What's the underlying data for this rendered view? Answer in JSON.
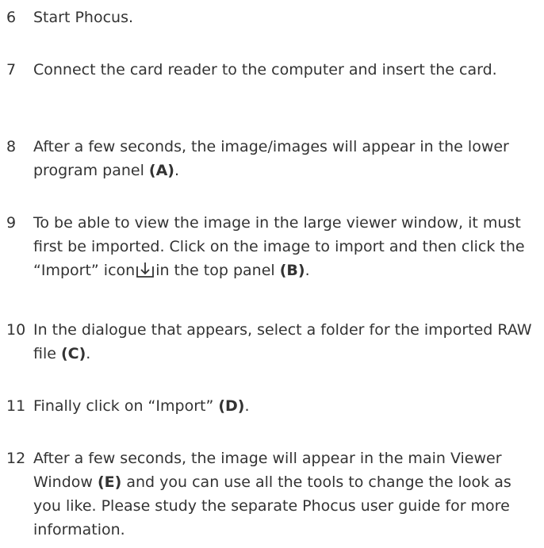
{
  "steps": [
    {
      "num": "6",
      "parts": [
        "Start Phocus."
      ]
    },
    {
      "num": "7",
      "parts": [
        "Connect the card reader to the computer and insert the card."
      ]
    },
    {
      "num": "8",
      "parts": [
        "After a few seconds, the image/images will appear in the lower program panel ",
        "(A)",
        "."
      ]
    },
    {
      "num": "9",
      "parts": [
        "To be able to view the image in the large viewer window, it must first be imported. Click on the image to import and then click the “Import” icon",
        "in the top panel ",
        "(B)",
        "."
      ]
    },
    {
      "num": "10",
      "parts": [
        "In the dialogue that appears, select a folder for the imported RAW file ",
        "(C)",
        "."
      ]
    },
    {
      "num": "11",
      "parts": [
        "Finally click on “Import” ",
        "(D)",
        "."
      ]
    },
    {
      "num": "12",
      "parts": [
        "After a few seconds, the image will appear in the main Viewer Window ",
        "(E)",
        " and you can use all the tools to change the look as you like. Please study the separate Phocus user guide for more information."
      ]
    }
  ],
  "icons": {
    "import_icon": "import-icon"
  }
}
